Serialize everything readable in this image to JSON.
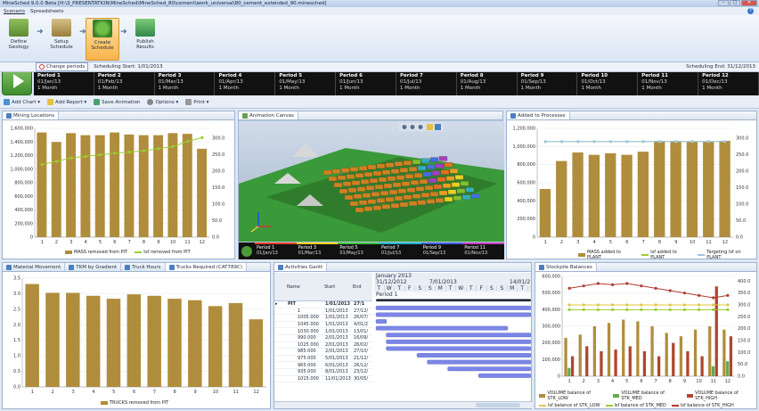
{
  "window": {
    "title": "MineSched 9.0.0 Beta   [H:\\3_PRESENTATION\\MineSched\\MineSched_80\\cement\\work_universal\\80_cement_extended_90.minesched]",
    "buttons": {
      "minimize": "–",
      "maximize": "□",
      "close": "✕"
    }
  },
  "menu": {
    "items": [
      "Scenario",
      "Spreadsheets"
    ],
    "help": "?"
  },
  "workflow": {
    "steps": [
      {
        "label": "Define Geology",
        "icon": "geology-icon"
      },
      {
        "label": "Setup Schedule",
        "icon": "setup-schedule-icon"
      },
      {
        "label": "Create Schedule",
        "icon": "create-schedule-icon",
        "active": true
      },
      {
        "label": "Publish Results",
        "icon": "publish-results-icon"
      }
    ]
  },
  "schedule": {
    "change_periods": "Change periods",
    "start": "Scheduling Start: 1/01/2013",
    "end": "Scheduling End: 31/12/2013"
  },
  "periods": [
    {
      "name": "Period 1",
      "date": "01/Jan/13",
      "len": "1 Month"
    },
    {
      "name": "Period 2",
      "date": "01/Feb/13",
      "len": "1 Month"
    },
    {
      "name": "Period 3",
      "date": "01/Mar/13",
      "len": "1 Month"
    },
    {
      "name": "Period 4",
      "date": "01/Apr/13",
      "len": "1 Month"
    },
    {
      "name": "Period 5",
      "date": "01/May/13",
      "len": "1 Month"
    },
    {
      "name": "Period 6",
      "date": "01/Jun/13",
      "len": "1 Month"
    },
    {
      "name": "Period 7",
      "date": "01/Jul/13",
      "len": "1 Month"
    },
    {
      "name": "Period 8",
      "date": "01/Aug/13",
      "len": "1 Month"
    },
    {
      "name": "Period 9",
      "date": "01/Sep/13",
      "len": "1 Month"
    },
    {
      "name": "Period 10",
      "date": "01/Oct/13",
      "len": "1 Month"
    },
    {
      "name": "Period 11",
      "date": "01/Nov/13",
      "len": "1 Month"
    },
    {
      "name": "Period 12",
      "date": "01/Dec/13",
      "len": "1 Month"
    }
  ],
  "toolbar": {
    "add_chart": "Add Chart ▾",
    "add_report": "Add Report ▾",
    "save_animation": "Save Animation",
    "options": "Options ▾",
    "print": "Print ▾"
  },
  "panels": {
    "mining": {
      "tab": "Mining Locations"
    },
    "animation": {
      "tab": "Animation Canvas"
    },
    "processes": {
      "tab": "Added to Processes"
    },
    "bottom_left_tabs": [
      "Material Movement",
      "TKM by Gradient",
      "Truck Hours",
      "Trucks Required (CAT789C)"
    ],
    "gantt": {
      "tab": "Activities Gantt"
    },
    "stockpile": {
      "tab": "Stockpile Balances"
    }
  },
  "animation_periods": [
    {
      "name": "Period 1",
      "date": "01/Jan/13",
      "color": "#e84030"
    },
    {
      "name": "Period 3",
      "date": "01/Mar/13",
      "color": "#f0d020"
    },
    {
      "name": "Period 5",
      "date": "01/May/13",
      "color": "#40c040"
    },
    {
      "name": "Period 7",
      "date": "01/Jul/13",
      "color": "#20b0d0"
    },
    {
      "name": "Period 9",
      "date": "01/Sep/13",
      "color": "#4060e0"
    },
    {
      "name": "Period 11",
      "date": "01/Nov/13",
      "color": "#c040c0"
    }
  ],
  "gantt": {
    "headers": [
      "Name",
      "Start",
      "End"
    ],
    "month": "January 2013",
    "dates": [
      "31/12/2012",
      "7/01/2013",
      "14/01/2"
    ],
    "days": [
      "T",
      "W",
      "T",
      "F",
      "S",
      "S",
      "M",
      "T",
      "W",
      "T",
      "F",
      "S",
      "S",
      "M",
      "T"
    ],
    "period_label": "Period 1",
    "rows": [
      {
        "name": "PIT",
        "start": "1/01/2013",
        "end": "27/1",
        "group": true
      },
      {
        "name": "1",
        "start": "1/01/2013",
        "end": "27/12/"
      },
      {
        "name": "1005.000",
        "start": "1/01/2013",
        "end": "26/07/"
      },
      {
        "name": "1045.000",
        "start": "1/01/2013",
        "end": "4/01/2"
      },
      {
        "name": "1030.000",
        "start": "1/01/2013",
        "end": "13/01/"
      },
      {
        "name": "990.000",
        "start": "2/01/2013",
        "end": "16/09/"
      },
      {
        "name": "1025.000",
        "start": "2/01/2013",
        "end": "26/02/"
      },
      {
        "name": "985.000",
        "start": "2/01/2013",
        "end": "27/10/"
      },
      {
        "name": "975.000",
        "start": "5/01/2013",
        "end": "21/12/"
      },
      {
        "name": "965.000",
        "start": "6/01/2013",
        "end": "26/12/"
      },
      {
        "name": "935.000",
        "start": "8/01/2013",
        "end": "23/12/"
      },
      {
        "name": "1015.000",
        "start": "11/01/2013",
        "end": "30/05/"
      }
    ]
  },
  "chart_data": [
    {
      "type": "bar",
      "categories": [
        "1",
        "2",
        "3",
        "4",
        "5",
        "6",
        "7",
        "8",
        "9",
        "10",
        "11",
        "12"
      ],
      "series": [
        {
          "name": "MASS removed from PIT",
          "values": [
            1540000,
            1400000,
            1530000,
            1500000,
            1500000,
            1540000,
            1510000,
            1500000,
            1500000,
            1530000,
            1520000,
            1300000
          ],
          "color": "#b08d3c"
        },
        {
          "name": "tsf removed from PIT",
          "values": [
            220,
            230,
            240,
            245,
            250,
            255,
            258,
            262,
            268,
            275,
            290,
            302
          ],
          "axis": "right",
          "color": "#9acd32"
        }
      ],
      "ylim": [
        0,
        1600000
      ],
      "y2lim": [
        0,
        330
      ],
      "yticks": [
        "0",
        "200,000",
        "400,000",
        "600,000",
        "800,000",
        "1,000,000",
        "1,200,000",
        "1,400,000",
        "1,600,000"
      ],
      "y2ticks": [
        "0.0",
        "50.0",
        "100.0",
        "150.0",
        "200.0",
        "250.0",
        "300.0"
      ]
    },
    {
      "type": "bar",
      "categories": [
        "1",
        "2",
        "3",
        "4",
        "5",
        "6",
        "7",
        "8",
        "9",
        "10",
        "11",
        "12"
      ],
      "series": [
        {
          "name": "MASS added to PLANT",
          "values": [
            620000,
            980000,
            1090000,
            1060000,
            1080000,
            1060000,
            1100000,
            1240000,
            1240000,
            1230000,
            1230000,
            1240000
          ],
          "color": "#b08d3c"
        },
        {
          "name": "lsf added to PLANT",
          "values": [
            290,
            290,
            290,
            290,
            290,
            290,
            290,
            290,
            290,
            290,
            290,
            290
          ],
          "axis": "right",
          "color": "#9acd32"
        },
        {
          "name": "Targeting lsf on PLANT",
          "values": [
            290,
            290,
            290,
            290,
            290,
            290,
            290,
            290,
            290,
            290,
            290,
            290
          ],
          "axis": "right",
          "color": "#a0c4e8"
        }
      ],
      "ylim": [
        0,
        1400000
      ],
      "y2lim": [
        0,
        330
      ],
      "yticks": [
        "0",
        "200,000",
        "400,000",
        "600,000",
        "800,000",
        "1,000,000",
        "1,200,000"
      ],
      "y2ticks": [
        "0.0",
        "50.0",
        "100.0",
        "150.0",
        "200.0",
        "250.0",
        "300.0"
      ]
    },
    {
      "type": "bar",
      "categories": [
        "1",
        "2",
        "3",
        "4",
        "5",
        "6",
        "7",
        "8",
        "9",
        "10",
        "11",
        "12"
      ],
      "series": [
        {
          "name": "TRUCKS removed from PIT",
          "values": [
            3.5,
            3.2,
            3.2,
            3.1,
            3.0,
            3.15,
            3.1,
            3.0,
            2.95,
            2.75,
            2.85,
            2.3
          ],
          "color": "#b08d3c"
        }
      ],
      "ylim": [
        0,
        3.7
      ],
      "yticks": [
        "0.0",
        "0.5",
        "1.0",
        "1.5",
        "2.0",
        "2.5",
        "3.0",
        "3.5"
      ]
    },
    {
      "type": "bar",
      "categories": [
        "1",
        "2",
        "3",
        "4",
        "5",
        "6",
        "7",
        "8",
        "9",
        "10",
        "11",
        "12"
      ],
      "series": [
        {
          "name": "VOLUME balance of STK_LOW",
          "values": [
            230000,
            250000,
            300000,
            320000,
            340000,
            330000,
            300000,
            260000,
            240000,
            280000,
            300000,
            280000
          ],
          "color": "#b08d3c"
        },
        {
          "name": "VOLUME balance of STK_MED",
          "values": [
            50000,
            0,
            0,
            0,
            0,
            0,
            0,
            0,
            0,
            0,
            60000,
            90000
          ],
          "color": "#6aa84f"
        },
        {
          "name": "VOLUME balance of STK_HIGH",
          "values": [
            120000,
            180000,
            150000,
            160000,
            180000,
            150000,
            120000,
            200000,
            150000,
            120000,
            540000,
            240000
          ],
          "color": "#b0462d"
        },
        {
          "name": "lsf balance of STK_LOW",
          "values": [
            300,
            300,
            300,
            300,
            300,
            300,
            300,
            300,
            300,
            300,
            300,
            300
          ],
          "axis": "right",
          "color": "#e0c840"
        },
        {
          "name": "lsf balance of STK_MED",
          "values": [
            280,
            280,
            280,
            280,
            280,
            280,
            280,
            280,
            280,
            280,
            280,
            280
          ],
          "axis": "right",
          "color": "#9acd32"
        },
        {
          "name": "lsf balance of STK_HIGH",
          "values": [
            370,
            380,
            390,
            385,
            390,
            380,
            370,
            360,
            350,
            340,
            330,
            340
          ],
          "axis": "right",
          "color": "#b03a2e"
        }
      ],
      "ylim": [
        0,
        600000
      ],
      "y2lim": [
        0,
        420
      ],
      "yticks": [
        "0",
        "100,000",
        "200,000",
        "300,000",
        "400,000",
        "500,000",
        "600,000"
      ],
      "y2ticks": [
        "0.0",
        "50.0",
        "100.0",
        "150.0",
        "200.0",
        "250.0",
        "300.0",
        "350.0",
        "400.0"
      ]
    }
  ]
}
